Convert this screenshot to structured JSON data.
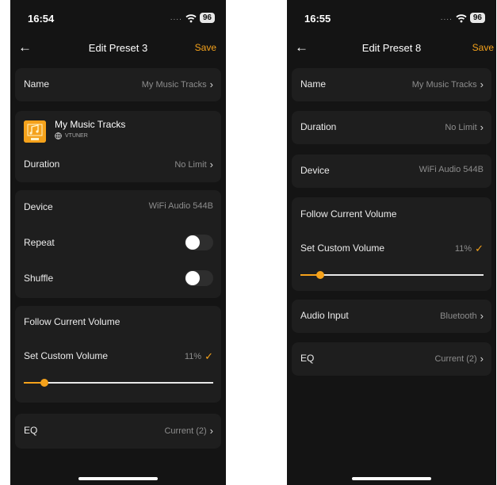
{
  "phones": [
    {
      "status": {
        "time": "16:54",
        "signal": "....",
        "battery": "96"
      },
      "nav": {
        "back": "←",
        "title": "Edit Preset 3",
        "save": "Save"
      },
      "name_row": {
        "label": "Name",
        "value": "My Music Tracks"
      },
      "track": {
        "name": "My Music Tracks",
        "source": "VTUNER"
      },
      "duration_row": {
        "label": "Duration",
        "value": "No Limit"
      },
      "device_row": {
        "label": "Device",
        "value": "WiFi Audio 544B"
      },
      "repeat_row": {
        "label": "Repeat",
        "on": false
      },
      "shuffle_row": {
        "label": "Shuffle",
        "on": false
      },
      "follow_volume": {
        "label": "Follow Current Volume"
      },
      "custom_volume": {
        "label": "Set Custom Volume",
        "value": "11%",
        "level": 0.11,
        "checked": true
      },
      "eq_row": {
        "label": "EQ",
        "value": "Current (2)"
      }
    },
    {
      "status": {
        "time": "16:55",
        "signal": "....",
        "battery": "96"
      },
      "nav": {
        "back": "←",
        "title": "Edit Preset 8",
        "save": "Save"
      },
      "name_row": {
        "label": "Name",
        "value": "My Music Tracks"
      },
      "duration_row": {
        "label": "Duration",
        "value": "No Limit"
      },
      "device_row": {
        "label": "Device",
        "value": "WiFi Audio 544B"
      },
      "follow_volume": {
        "label": "Follow Current Volume"
      },
      "custom_volume": {
        "label": "Set Custom Volume",
        "value": "11%",
        "level": 0.11,
        "checked": true
      },
      "audio_input_row": {
        "label": "Audio Input",
        "value": "Bluetooth"
      },
      "eq_row": {
        "label": "EQ",
        "value": "Current (2)"
      }
    }
  ],
  "icons": {
    "chevron": "chevron-right-icon",
    "check": "checkmark-icon",
    "back": "arrow-left-icon",
    "wifi": "wifi-icon",
    "globe": "globe-icon",
    "album_art": "music-note-art-icon"
  },
  "colors": {
    "accent": "#f5a21b",
    "background": "#141414",
    "card": "#1e1e1e"
  }
}
